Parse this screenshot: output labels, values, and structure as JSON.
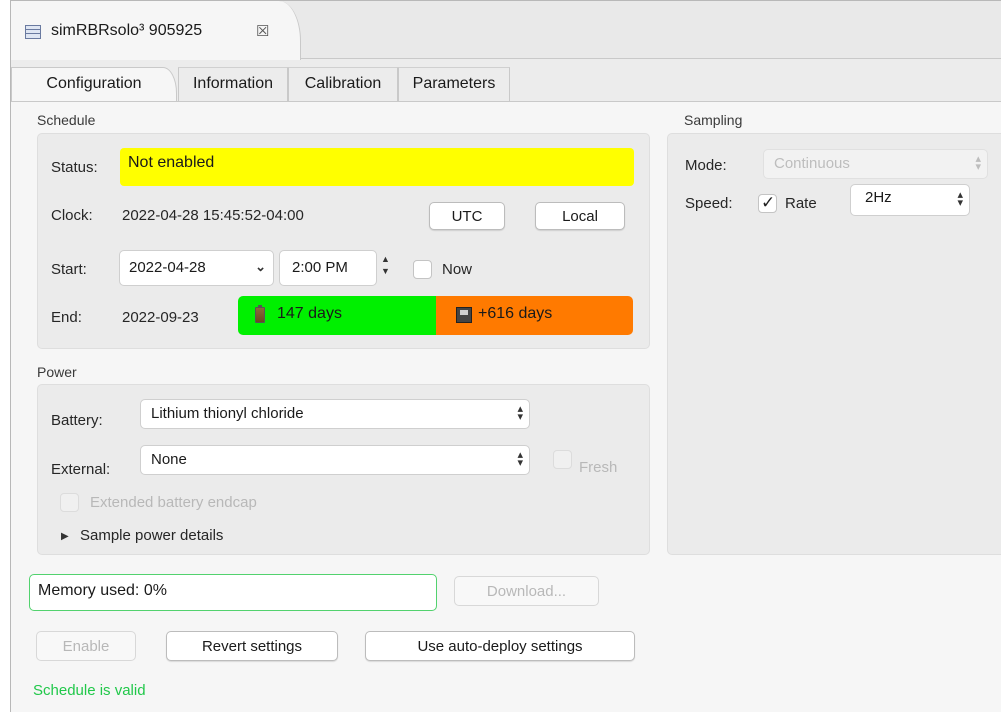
{
  "editor_tab": {
    "title": "simRBRsolo³ 905925",
    "close_glyph": "☒",
    "icon": "table-icon"
  },
  "tabs": [
    {
      "label": "Configuration",
      "active": true
    },
    {
      "label": "Information",
      "active": false
    },
    {
      "label": "Calibration",
      "active": false
    },
    {
      "label": "Parameters",
      "active": false
    }
  ],
  "schedule": {
    "group_label": "Schedule",
    "status_label": "Status:",
    "status_value": "Not enabled",
    "status_color": "#ffff00",
    "clock_label": "Clock:",
    "clock_value": "2022-04-28 15:45:52-04:00",
    "utc_button": "UTC",
    "local_button": "Local",
    "start_label": "Start:",
    "start_date": "2022-04-28",
    "start_time": "2:00 PM",
    "now_label": "Now",
    "now_checked": false,
    "end_label": "End:",
    "end_date": "2022-09-23",
    "battery_days": "147 days",
    "memory_days": "+616 days",
    "battery_days_color": "#00f000",
    "memory_days_color": "#ff7a00"
  },
  "power": {
    "group_label": "Power",
    "battery_label": "Battery:",
    "battery_value": "Lithium thionyl chloride",
    "external_label": "External:",
    "external_value": "None",
    "fresh_label": "Fresh",
    "fresh_enabled": false,
    "extended_endcap_label": "Extended battery endcap",
    "extended_endcap_enabled": false,
    "details_label": "Sample power details"
  },
  "sampling": {
    "group_label": "Sampling",
    "mode_label": "Mode:",
    "mode_value": "Continuous",
    "mode_enabled": false,
    "speed_label": "Speed:",
    "rate_label": "Rate",
    "rate_checked": true,
    "rate_value": "2Hz"
  },
  "memory": {
    "used_text": "Memory used: 0%",
    "border_color": "#52d26e"
  },
  "download_button": "Download...",
  "buttons": {
    "enable": "Enable",
    "revert": "Revert settings",
    "auto_deploy": "Use auto-deploy settings"
  },
  "validation_message": "Schedule is valid",
  "validation_color": "#21c84a"
}
